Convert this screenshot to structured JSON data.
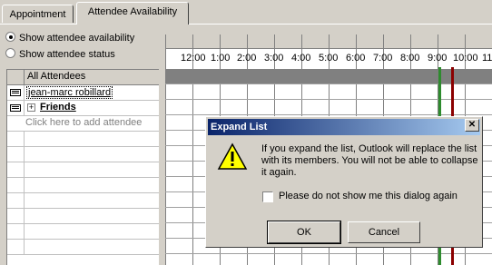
{
  "tabs": [
    {
      "label": "Appointment"
    },
    {
      "label": "Attendee Availability"
    }
  ],
  "options": {
    "show_availability": "Show attendee availability",
    "show_status": "Show attendee status",
    "selected": "Show attendee availability"
  },
  "attendees": {
    "header": "All Attendees",
    "rows": [
      {
        "name": "jean-marc robillard",
        "icon": "mail-icon"
      },
      {
        "name": "Friends",
        "icon": "distribution-list-icon",
        "expandable": true
      }
    ],
    "add_placeholder": "Click here to add attendee"
  },
  "schedule": {
    "times": [
      "12:00",
      "1:00",
      "2:00",
      "3:00",
      "4:00",
      "5:00",
      "6:00",
      "7:00",
      "8:00",
      "9:00",
      "10:00",
      "11"
    ]
  },
  "dialog": {
    "title": "Expand List",
    "message": "If you expand the list, Outlook will replace the list with its members.  You will not be able to collapse it again.",
    "checkbox_label": "Please do not show me this dialog again",
    "ok_label": "OK",
    "cancel_label": "Cancel",
    "icon": "warning-icon"
  },
  "colors": {
    "title_start": "#0a246a",
    "title_end": "#a6caf0",
    "marker_start": "#2e8b2e",
    "marker_end": "#8b0000"
  }
}
